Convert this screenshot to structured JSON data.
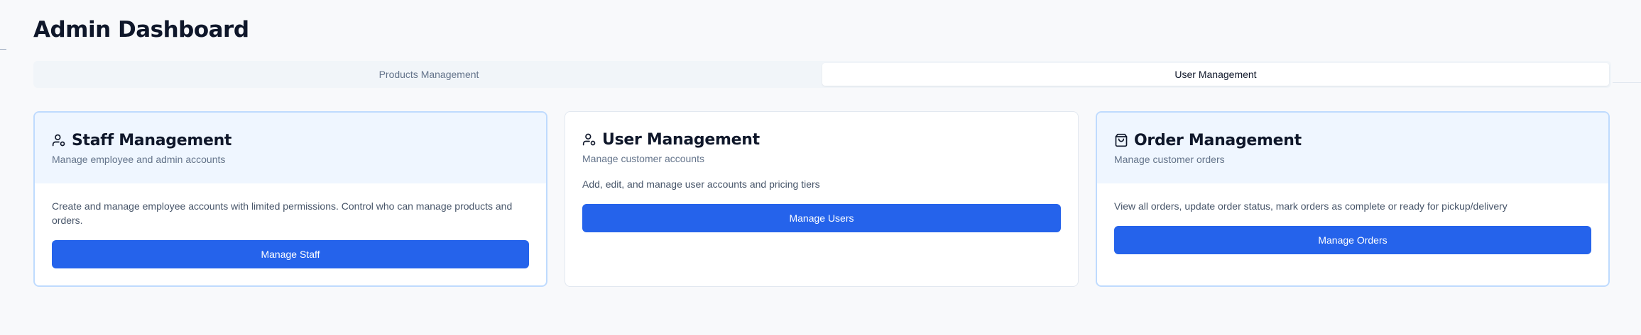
{
  "page": {
    "title": "Admin Dashboard"
  },
  "tabs": [
    {
      "label": "Products Management",
      "active": false
    },
    {
      "label": "User Management",
      "active": true
    }
  ],
  "cards": [
    {
      "title": "Staff Management",
      "icon": "user-cog-icon",
      "description": "Manage employee and admin accounts",
      "text": "Create and manage employee accounts with limited permissions. Control who can manage products and orders.",
      "button": "Manage Staff",
      "highlighted": true
    },
    {
      "title": "User Management",
      "icon": "user-cog-icon",
      "description": "Manage customer accounts",
      "text": "Add, edit, and manage user accounts and pricing tiers",
      "button": "Manage Users",
      "highlighted": false
    },
    {
      "title": "Order Management",
      "icon": "shopping-bag-icon",
      "description": "Manage customer orders",
      "text": "View all orders, update order status, mark orders as complete or ready for pickup/delivery",
      "button": "Manage Orders",
      "highlighted": true
    }
  ],
  "colors": {
    "primary": "#2563eb",
    "highlight_bg": "#eff6ff",
    "highlight_border": "#bfdbfe"
  }
}
